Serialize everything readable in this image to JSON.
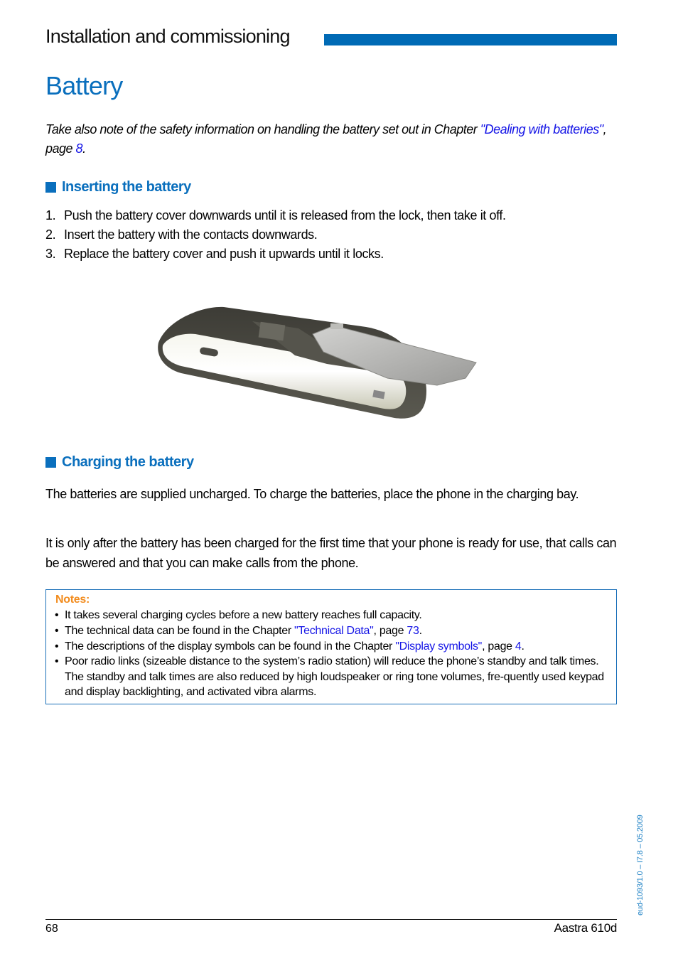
{
  "header": {
    "section": "Installation and commissioning",
    "accent_color": "#006ab5"
  },
  "title": "Battery",
  "intro": {
    "text_before": "Take also note of the safety information on handling the battery set out in Chapter ",
    "link_text": "\"Dealing with batteries\"",
    "text_middle": ", page ",
    "page_link": "8",
    "text_after": "."
  },
  "inserting": {
    "heading": "Inserting the battery",
    "steps": [
      {
        "num": "1.",
        "text": "Push the battery cover downwards until it is released from the lock, then take it off."
      },
      {
        "num": "2.",
        "text": "Insert the battery with the contacts downwards."
      },
      {
        "num": "3.",
        "text": "Replace the battery cover and push it upwards until it locks."
      }
    ],
    "image_alt": "phone-with-battery-cover-removed"
  },
  "charging": {
    "heading": "Charging the battery",
    "paragraphs": [
      "The batteries are supplied uncharged. To charge the batteries, place the phone in the charging bay.",
      "It is only after the battery has been charged for the first time that your phone is ready for use, that calls can be answered and that you can make calls from the phone."
    ]
  },
  "notes": {
    "title": "Notes:",
    "title_color": "#f28c1e",
    "items": [
      {
        "text": "It takes several charging cycles before a new battery reaches full capacity."
      },
      {
        "before": "The technical data can be found in the Chapter ",
        "link": "\"Technical Data\"",
        "middle": ", page ",
        "page": "73",
        "after": "."
      },
      {
        "before": "The descriptions of the display symbols can be found in the Chapter ",
        "link": "\"Display symbols\"",
        "middle": ", page ",
        "page": "4",
        "after": "."
      },
      {
        "text": "Poor radio links (sizeable distance to the system’s radio station) will reduce the phone’s standby and talk times. The standby and talk times are also reduced by high loudspeaker or ring tone volumes, fre-quently used keypad and display backlighting, and activated vibra alarms."
      }
    ]
  },
  "footer": {
    "page_number": "68",
    "product": "Aastra 610d",
    "doc_code": "eud-1093/1.0 – I7.8 – 05.2009"
  }
}
